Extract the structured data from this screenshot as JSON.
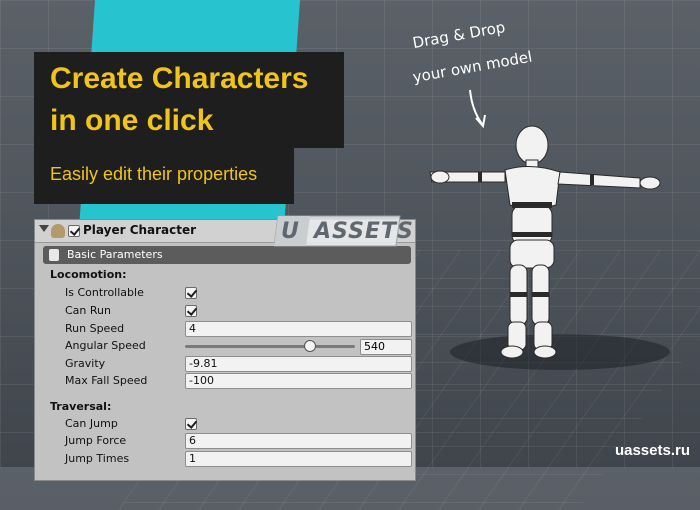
{
  "banner": {
    "title_line1": "Create Characters",
    "title_line2": "in one click",
    "subtitle": "Easily edit their properties",
    "drag_line1": "Drag & Drop",
    "drag_line2": "your own model"
  },
  "watermark": {
    "u": "U",
    "assets": "ASSETS"
  },
  "site": "uassets.ru",
  "colors": {
    "title": "#f0c419",
    "panel": "#27c4cf",
    "inspector_bg": "#c2c2c2"
  },
  "inspector": {
    "component_title": "Player Character",
    "enabled": true,
    "section": "Basic Parameters",
    "locomotion": {
      "label": "Locomotion:",
      "is_controllable_label": "Is Controllable",
      "is_controllable": true,
      "can_run_label": "Can Run",
      "can_run": true,
      "run_speed_label": "Run Speed",
      "run_speed": "4",
      "angular_speed_label": "Angular Speed",
      "angular_speed": "540",
      "angular_speed_fraction": 0.69,
      "gravity_label": "Gravity",
      "gravity": "-9.81",
      "max_fall_speed_label": "Max Fall Speed",
      "max_fall_speed": "-100"
    },
    "traversal": {
      "label": "Traversal:",
      "can_jump_label": "Can Jump",
      "can_jump": true,
      "jump_force_label": "Jump Force",
      "jump_force": "6",
      "jump_times_label": "Jump Times",
      "jump_times": "1"
    }
  }
}
